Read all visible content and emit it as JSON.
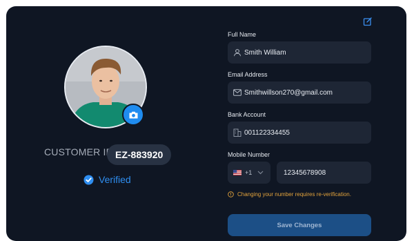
{
  "profile": {
    "customer_id_label": "CUSTOMER ID",
    "customer_id": "EZ-883920",
    "verified_label": "Verified"
  },
  "form": {
    "full_name_label": "Full Name",
    "full_name": "Smith William",
    "email_label": "Email Address",
    "email": "Smithwillson270@gmail.com",
    "bank_label": "Bank Account",
    "bank_account": "001122334455",
    "mobile_label": "Mobile Number",
    "country_code": "+1",
    "mobile": "12345678908",
    "warning": "Changing your number requires re-verification.",
    "save_label": "Save Changes"
  },
  "icons": {
    "edit": "edit-icon",
    "camera": "camera-icon",
    "verified": "check-badge-icon",
    "user": "user-icon",
    "email": "mail-icon",
    "bank": "building-icon",
    "flag": "us-flag-icon",
    "chevron": "chevron-down-icon",
    "warning": "alert-circle-icon"
  },
  "colors": {
    "background": "#0f1623",
    "field": "#1e2635",
    "accent": "#1f8cf0",
    "warning": "#e3a33c",
    "save_button": "#1c4f86"
  }
}
